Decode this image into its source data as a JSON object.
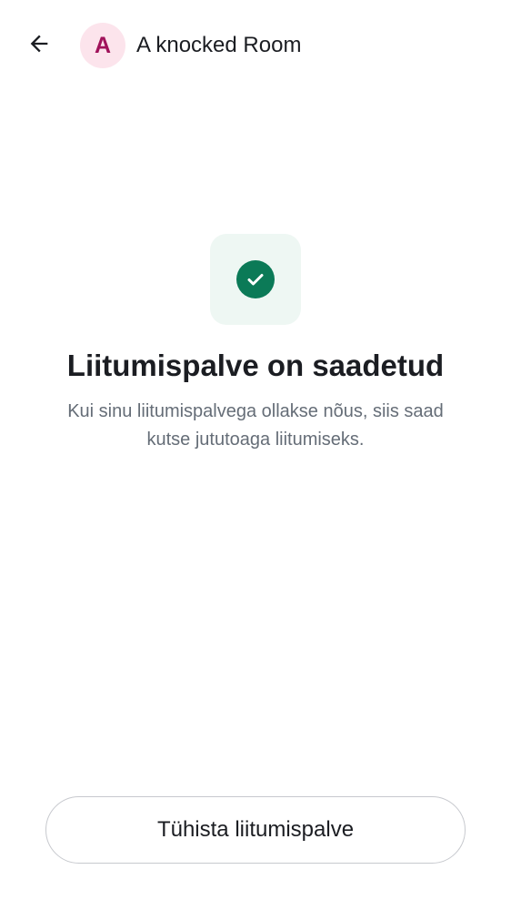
{
  "header": {
    "back_icon": "arrow-left-icon",
    "avatar_letter": "A",
    "room_name": "A knocked Room"
  },
  "status": {
    "icon": "check-circle-icon",
    "title": "Liitumispalve on saadetud",
    "description": "Kui sinu liitumispalvega ollakse nõus, siis saad kutse jututoaga liitumiseks."
  },
  "actions": {
    "cancel_label": "Tühista liitumispalve"
  },
  "colors": {
    "accent_green": "#0b7a57",
    "icon_tile_bg": "#eef7f3",
    "avatar_bg": "#fce4ec",
    "avatar_fg": "#a0125a"
  }
}
